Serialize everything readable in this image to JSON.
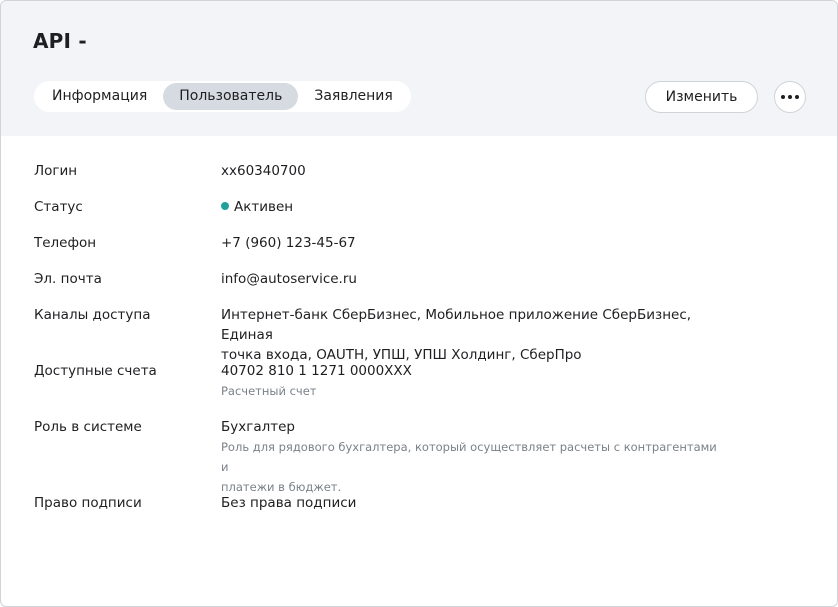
{
  "page_title": "API -",
  "tabs": [
    {
      "label": "Информация",
      "active": false
    },
    {
      "label": "Пользователь",
      "active": true
    },
    {
      "label": "Заявления",
      "active": false
    }
  ],
  "edit_label": "Изменить",
  "more_icon": "more-horizontal-icon",
  "status_color": "#21a19a",
  "fields": {
    "login": {
      "label": "Логин",
      "value": "xx60340700"
    },
    "status": {
      "label": "Статус",
      "value": "Активен"
    },
    "phone": {
      "label": "Телефон",
      "value": "+7 (960) 123-45-67"
    },
    "email": {
      "label": "Эл. почта",
      "value": "info@autoservice.ru"
    },
    "channels": {
      "label": "Каналы доступа",
      "value_line1": "Интернет-банк СберБизнес, Мобильное приложение СберБизнес, Единая",
      "value_line2": "точка входа, OAUTH, УПШ, УПШ Холдинг, СберПро"
    },
    "accounts": {
      "label": "Доступные счета",
      "value": "40702 810 1 1271 0000XXX",
      "sub": "Расчетный счет"
    },
    "role": {
      "label": "Роль в системе",
      "value": "Бухгалтер",
      "sub_line1": "Роль для рядового бухгалтера, который осуществляет расчеты с контрагентами и",
      "sub_line2": "платежи в бюджет."
    },
    "signature": {
      "label": "Право подписи",
      "value": "Без права подписи"
    }
  }
}
